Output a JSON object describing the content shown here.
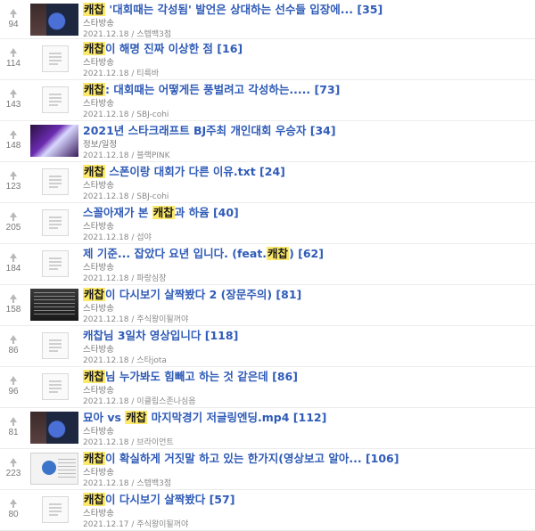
{
  "posts": [
    {
      "votes": "94",
      "pre": "",
      "hl": "캐찹",
      "post": " '대회때는 각성됨' 발언은 상대하는 선수들 입장에...",
      "comments": "[35]",
      "category": "스타방송",
      "meta": "2021.12.18 / 스텝백3점",
      "thumb": "img-blue"
    },
    {
      "votes": "114",
      "pre": "",
      "hl": "캐찹",
      "post": "이 해명 진짜 이상한 점",
      "comments": "[16]",
      "category": "스타방송",
      "meta": "2021.12.18 / 티륵바",
      "thumb": "placeholder"
    },
    {
      "votes": "143",
      "pre": "",
      "hl": "캐찹",
      "post": ": 대회때는 어떻게든 풍벌려고 각성하는.....",
      "comments": "[73]",
      "category": "스타방송",
      "meta": "2021.12.18 / SBJ-cohi",
      "thumb": "placeholder"
    },
    {
      "votes": "148",
      "pre": "2021년 스타크래프트 BJ주최 개인대회 우승자",
      "hl": "",
      "post": "",
      "comments": "[34]",
      "category": "정보/일정",
      "meta": "2021.12.18 / 블랙PINK",
      "thumb": "img-purple"
    },
    {
      "votes": "123",
      "pre": "",
      "hl": "캐찹",
      "post": " 스폰이랑 대회가 다른 이유.txt",
      "comments": "[24]",
      "category": "스타방송",
      "meta": "2021.12.18 / SBJ-cohi",
      "thumb": "placeholder"
    },
    {
      "votes": "205",
      "pre": "스꼴아재가 본 ",
      "hl": "캐찹",
      "post": "과 하윰",
      "comments": "[40]",
      "category": "스타방송",
      "meta": "2021.12.18 / 섭야",
      "thumb": "placeholder"
    },
    {
      "votes": "184",
      "pre": "제 기준... 잡았다 요년 입니다. (feat.",
      "hl": "캐찹",
      "post": ")",
      "comments": "[62]",
      "category": "스타방송",
      "meta": "2021.12.18 / 파랑심장",
      "thumb": "placeholder"
    },
    {
      "votes": "158",
      "pre": "",
      "hl": "캐찹",
      "post": "이 다시보기 살짝봤다 2 (장문주의)",
      "comments": "[81]",
      "category": "스타방송",
      "meta": "2021.12.18 / 주식왕이될꺼야",
      "thumb": "img-dark"
    },
    {
      "votes": "86",
      "pre": "캐찹님 3일차 영상입니다",
      "hl": "",
      "post": "",
      "comments": "[118]",
      "category": "스타방송",
      "meta": "2021.12.18 / 스타jota",
      "thumb": "placeholder"
    },
    {
      "votes": "96",
      "pre": "",
      "hl": "캐찹",
      "post": "님 누가봐도 힘빼고 하는 것 같은데",
      "comments": "[86]",
      "category": "스타방송",
      "meta": "2021.12.18 / 이클립스존나심음",
      "thumb": "placeholder"
    },
    {
      "votes": "81",
      "pre": "묘아 vs ",
      "hl": "캐찹",
      "post": " 마지막경기 저글링엔딩.mp4",
      "comments": "[112]",
      "category": "스타방송",
      "meta": "2021.12.18 / 브라이언트",
      "thumb": "img-blue"
    },
    {
      "votes": "223",
      "pre": "",
      "hl": "캐찹",
      "post": "이 확실하게 거짓말 하고 있는 한가지(영상보고 알아...",
      "comments": "[106]",
      "category": "스타방송",
      "meta": "2021.12.18 / 스텝백3점",
      "thumb": "img-doc"
    },
    {
      "votes": "80",
      "pre": "",
      "hl": "캐찹",
      "post": "이 다시보기 살짝봤다",
      "comments": "[57]",
      "category": "스타방송",
      "meta": "2021.12.17 / 주식왕이될꺼야",
      "thumb": "placeholder"
    }
  ]
}
